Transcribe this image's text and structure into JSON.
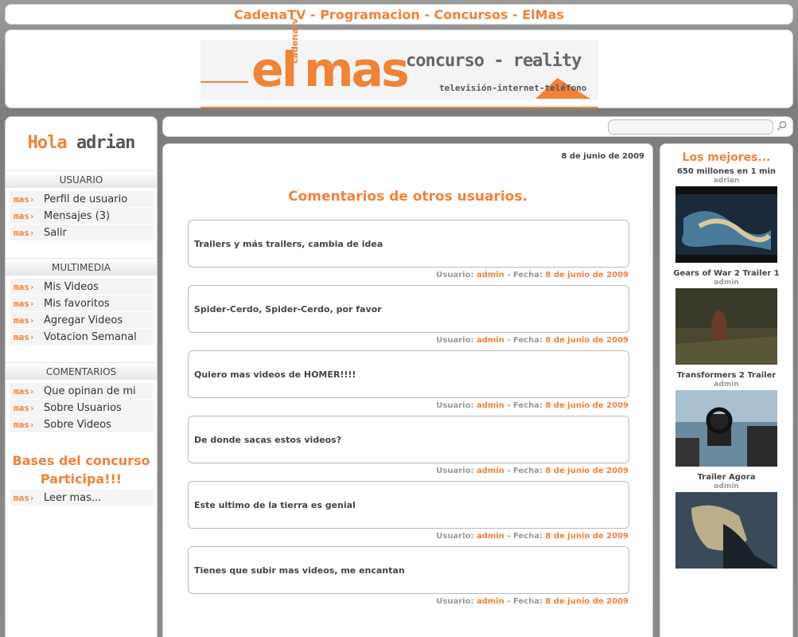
{
  "topbar": {
    "title": "CadenaTV - Programacion - Concursos - ElMas"
  },
  "logo": {
    "el": "el",
    "cadena": "cadenatv",
    "mas": "mas",
    "concurso": "concurso - reality",
    "tv": "televisión-internet-teléfono"
  },
  "user": {
    "greeting": "Hola",
    "name": "adrian"
  },
  "sidebar": {
    "mas_label": "mas",
    "sections": [
      {
        "title": "USUARIO",
        "items": [
          "Perfil de usuario",
          "Mensajes (3)",
          "Salir"
        ]
      },
      {
        "title": "MULTIMEDIA",
        "items": [
          "Mis Videos",
          "Mis favoritos",
          "Agregar Videos",
          "Votacion Semanal"
        ]
      },
      {
        "title": "COMENTARIOS",
        "items": [
          "Que opinan de mi",
          "Sobre Usuarios",
          "Sobre Videos"
        ]
      }
    ],
    "bases_line1": "Bases del concurso",
    "bases_line2": "Participa!!!",
    "bases_link": "Leer mas..."
  },
  "search": {
    "value": "",
    "placeholder": ""
  },
  "main": {
    "date": "8 de junio de 2009",
    "title": "Comentarios de otros usuarios.",
    "meta_user_label": "Usuario:",
    "meta_date_label": "- Fecha:",
    "comments": [
      {
        "text": "Trailers y más trailers, cambia de idea",
        "user": "admin",
        "date": "8 de junio de 2009"
      },
      {
        "text": "Spider-Cerdo, Spider-Cerdo, por favor",
        "user": "admin",
        "date": "8 de junio de 2009"
      },
      {
        "text": "Quiero mas videos de HOMER!!!!",
        "user": "admin",
        "date": "8 de junio de 2009"
      },
      {
        "text": "De donde sacas estos videos?",
        "user": "admin",
        "date": "8 de junio de 2009"
      },
      {
        "text": "Este ultimo de la tierra es genial",
        "user": "admin",
        "date": "8 de junio de 2009"
      },
      {
        "text": "Tienes que subir mas videos, me encantan",
        "user": "admin",
        "date": "8 de junio de 2009"
      }
    ]
  },
  "best": {
    "title": "Los mejores...",
    "videos": [
      {
        "title": "650 millones en 1 min",
        "user": "adrian"
      },
      {
        "title": "Gears of War 2 Trailer 1",
        "user": "admin"
      },
      {
        "title": "Transformers 2 Trailer",
        "user": "admin"
      },
      {
        "title": "Trailer Agora",
        "user": "admin"
      }
    ]
  },
  "colors": {
    "accent": "#f0823a",
    "background": "#8a8a8a",
    "text": "#444444"
  }
}
